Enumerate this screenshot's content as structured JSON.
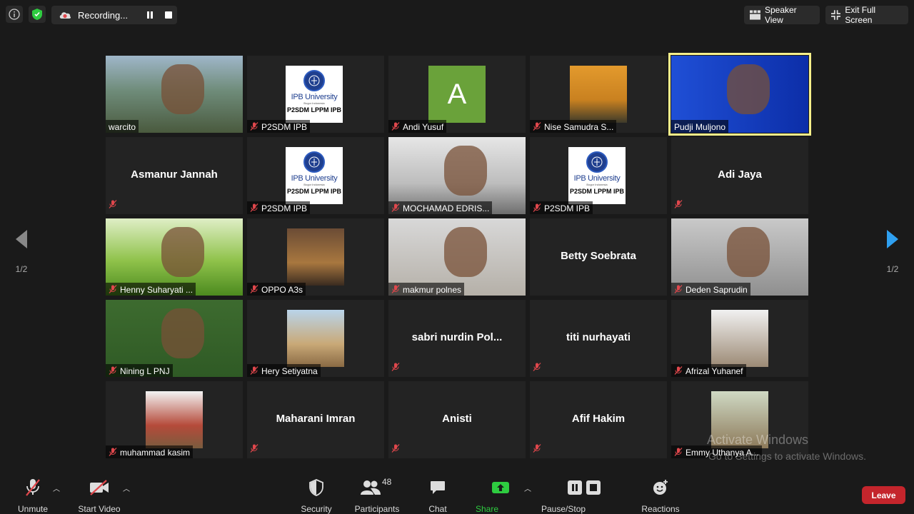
{
  "topbar": {
    "recording_label": "Recording...",
    "speaker_view_label": "Speaker View",
    "exit_fullscreen_label": "Exit Full Screen"
  },
  "pager": {
    "left_label": "1/2",
    "right_label": "1/2"
  },
  "participants": [
    {
      "name": "warcito",
      "kind": "photo",
      "muted": false
    },
    {
      "name": "P2SDM IPB",
      "kind": "ipb",
      "muted": true
    },
    {
      "name": "Andi Yusuf",
      "kind": "letter",
      "letter": "A",
      "muted": true
    },
    {
      "name": "Nise Samudra S...",
      "kind": "photo-square",
      "muted": true
    },
    {
      "name": "Pudji Muljono",
      "kind": "photo",
      "muted": false,
      "active": true
    },
    {
      "name": "Asmanur Jannah",
      "kind": "name-only",
      "muted": true
    },
    {
      "name": "P2SDM IPB",
      "kind": "ipb",
      "muted": true
    },
    {
      "name": "MOCHAMAD EDRIS...",
      "kind": "photo",
      "muted": true
    },
    {
      "name": "P2SDM IPB",
      "kind": "ipb",
      "muted": true
    },
    {
      "name": "Adi Jaya",
      "kind": "name-only",
      "muted": true
    },
    {
      "name": "Henny Suharyati ...",
      "kind": "photo",
      "muted": true
    },
    {
      "name": "OPPO A3s",
      "kind": "photo-square",
      "muted": true
    },
    {
      "name": "makmur polnes",
      "kind": "photo",
      "muted": true
    },
    {
      "name": "Betty Soebrata",
      "kind": "name-only",
      "muted": false
    },
    {
      "name": "Deden Saprudin",
      "kind": "photo",
      "muted": true
    },
    {
      "name": "Nining L PNJ",
      "kind": "photo",
      "muted": true
    },
    {
      "name": "Hery Setiyatna",
      "kind": "photo-square",
      "muted": true
    },
    {
      "name": "sabri  nurdin Pol...",
      "kind": "name-only",
      "muted": true
    },
    {
      "name": "titi nurhayati",
      "kind": "name-only",
      "muted": true
    },
    {
      "name": "Afrizal Yuhanef",
      "kind": "photo-square",
      "muted": true
    },
    {
      "name": "muhammad kasim",
      "kind": "photo-square",
      "muted": true
    },
    {
      "name": "Maharani Imran",
      "kind": "name-only",
      "muted": true
    },
    {
      "name": "Anisti",
      "kind": "name-only",
      "muted": true
    },
    {
      "name": "Afif Hakim",
      "kind": "name-only",
      "muted": true
    },
    {
      "name": "Emmy Uthanya A...",
      "kind": "photo-square",
      "muted": true
    }
  ],
  "ipb": {
    "title": "IPB University",
    "subtitle": "Bogor Indonesia",
    "caption": "P2SDM LPPM IPB"
  },
  "watermark": {
    "line1": "Activate Windows",
    "line2": "Go to Settings to activate Windows."
  },
  "toolbar": {
    "unmute": "Unmute",
    "start_video": "Start Video",
    "security": "Security",
    "participants": "Participants",
    "participants_count": "48",
    "chat": "Chat",
    "share_screen": "Share Screen",
    "pause_stop_recording": "Pause/Stop Recording",
    "reactions": "Reactions",
    "leave": "Leave"
  },
  "colors": {
    "share_green": "#2ecc40",
    "leave_red": "#c4252c",
    "active_outline": "#f7f08a",
    "ipb_blue": "#1f3f8f"
  }
}
